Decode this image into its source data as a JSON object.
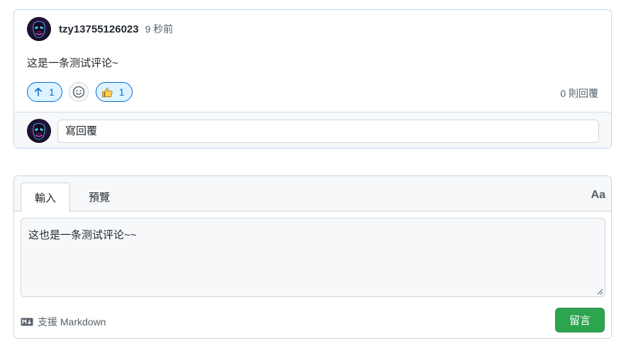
{
  "comment": {
    "author": "tzy13755126023",
    "time": "9 秒前",
    "body": "这是一条测试评论~",
    "reactions": {
      "upvote_count": "1",
      "thumbs_up_count": "1"
    },
    "reply_count": "0 則回覆",
    "reply_placeholder": "寫回覆"
  },
  "editor": {
    "tab_write": "輸入",
    "tab_preview": "預覽",
    "font_toggle": "Aa",
    "text_value": "这也是一条测试评论~~",
    "markdown_note": "支援 Markdown",
    "submit_label": "留言"
  },
  "icons": {
    "upvote": "arrow-up-icon",
    "emoji": "smiley-icon",
    "thumbs": "thumbs-up-icon",
    "markdown": "markdown-icon"
  },
  "colors": {
    "accent": "#0969da",
    "accent_bg": "#ddf4ff",
    "submit": "#2da44e",
    "card_border": "#c6dcf0"
  }
}
